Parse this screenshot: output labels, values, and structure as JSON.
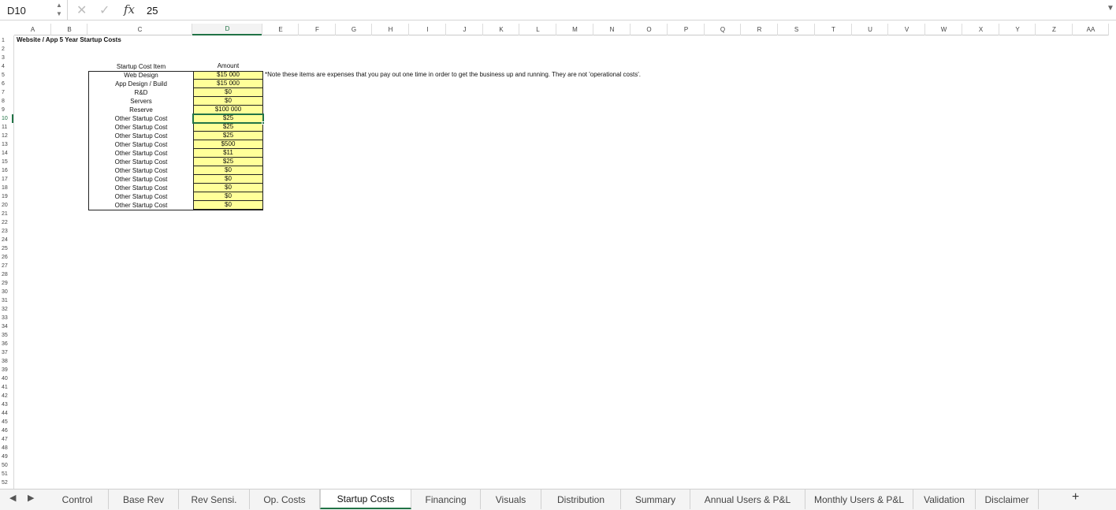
{
  "formula_bar": {
    "name_box": "D10",
    "cancel_glyph": "✕",
    "enter_glyph": "✓",
    "fx_label": "fx",
    "value": "25"
  },
  "columns": [
    "A",
    "B",
    "C",
    "D",
    "E",
    "F",
    "G",
    "H",
    "I",
    "J",
    "K",
    "L",
    "M",
    "N",
    "O",
    "P",
    "Q",
    "R",
    "S",
    "T",
    "U",
    "V",
    "W",
    "X",
    "Y",
    "Z",
    "AA"
  ],
  "selected_column": "D",
  "selected_row": 10,
  "rows": [
    "1",
    "2",
    "3",
    "4",
    "5",
    "6",
    "7",
    "8",
    "9",
    "10",
    "11",
    "12",
    "13",
    "14",
    "15",
    "16",
    "17",
    "18",
    "19",
    "20",
    "21",
    "22",
    "23",
    "24",
    "25",
    "26",
    "27",
    "28",
    "29",
    "30",
    "31",
    "32",
    "33",
    "34",
    "35",
    "36",
    "37",
    "38",
    "39",
    "40",
    "41",
    "42",
    "43",
    "44",
    "45",
    "46",
    "47",
    "48",
    "49",
    "50",
    "51",
    "52"
  ],
  "sheet": {
    "title": "Website / App 5 Year Startup Costs",
    "table_header_item": "Startup Cost Item",
    "table_header_amount": "Amount",
    "note": "*Note these items are expenses that you pay out one time in order to get the business up and running. They are not 'operational costs'.",
    "items": [
      {
        "name": "Web Design",
        "amount": "$15 000"
      },
      {
        "name": "App Design / Build",
        "amount": "$15 000"
      },
      {
        "name": "R&D",
        "amount": "$0"
      },
      {
        "name": "Servers",
        "amount": "$0"
      },
      {
        "name": "Reserve",
        "amount": "$100 000"
      },
      {
        "name": "Other Startup Cost",
        "amount": "$25"
      },
      {
        "name": "Other Startup Cost",
        "amount": "$25"
      },
      {
        "name": "Other Startup Cost",
        "amount": "$25"
      },
      {
        "name": "Other Startup Cost",
        "amount": "$500"
      },
      {
        "name": "Other Startup Cost",
        "amount": "$11"
      },
      {
        "name": "Other Startup Cost",
        "amount": "$25"
      },
      {
        "name": "Other Startup Cost",
        "amount": "$0"
      },
      {
        "name": "Other Startup Cost",
        "amount": "$0"
      },
      {
        "name": "Other Startup Cost",
        "amount": "$0"
      },
      {
        "name": "Other Startup Cost",
        "amount": "$0"
      },
      {
        "name": "Other Startup Cost",
        "amount": "$0"
      }
    ]
  },
  "tabs": [
    "Control",
    "Base Rev",
    "Rev Sensi.",
    "Op. Costs",
    "Startup Costs",
    "Financing",
    "Visuals",
    "Distribution",
    "Summary",
    "Annual Users & P&L",
    "Monthly Users & P&L",
    "Validation",
    "Disclaimer"
  ],
  "active_tab": "Startup Costs",
  "nav": {
    "prev": "◀",
    "next": "▶",
    "add": "+"
  },
  "colors": {
    "accent": "#217346",
    "input_fill": "#ffff99"
  }
}
